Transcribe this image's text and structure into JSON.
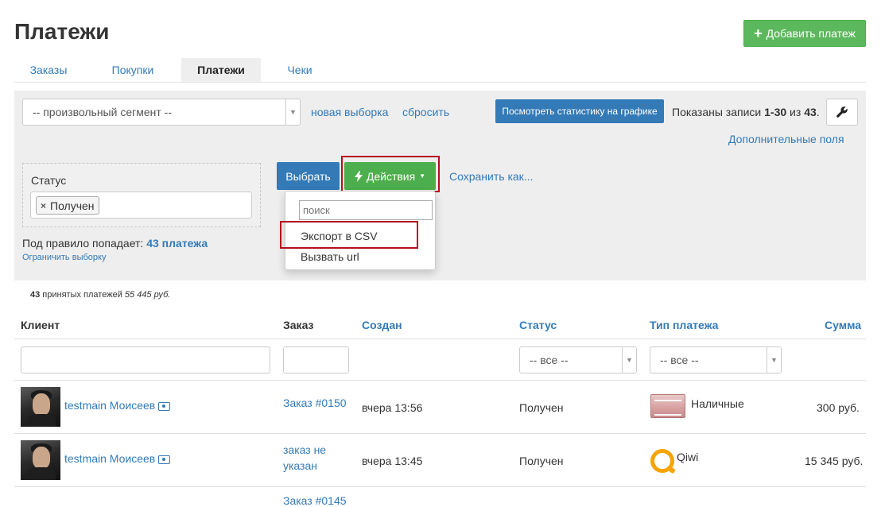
{
  "header": {
    "title": "Платежи",
    "add_button": "Добавить платеж"
  },
  "tabs": [
    {
      "label": "Заказы"
    },
    {
      "label": "Покупки"
    },
    {
      "label": "Платежи",
      "active": true
    },
    {
      "label": "Чеки"
    }
  ],
  "filter": {
    "segment_select": "-- произвольный сегмент --",
    "new_selection": "новая выборка",
    "reset": "сбросить",
    "stats_button": "Посмотреть статистику на графике",
    "shown_prefix": "Показаны записи ",
    "shown_range": "1-30",
    "shown_mid": " из ",
    "shown_total": "43",
    "shown_suffix": ".",
    "extra_fields": "Дополнительные поля",
    "status_label": "Статус",
    "status_tag": "Получен",
    "rule_prefix": "Под правило попадает: ",
    "rule_count": "43 платежа",
    "limit_link": "Ограничить выборку",
    "choose_button": "Выбрать",
    "actions_button": "Действия",
    "save_as": "Сохранить как..."
  },
  "actions_dropdown": {
    "search_placeholder": "поиск",
    "items": [
      "Экспорт в CSV",
      "Вызвать url"
    ]
  },
  "summary": {
    "count": "43",
    "text": " принятых платежей ",
    "amount": "55 445 руб."
  },
  "table": {
    "headers": {
      "client": "Клиент",
      "order": "Заказ",
      "created": "Создан",
      "status": "Статус",
      "payment_type": "Тип платежа",
      "amount": "Сумма"
    },
    "status_filter": "-- все --",
    "type_filter": "-- все --",
    "rows": [
      {
        "client": "testmain Моисеев",
        "order": "Заказ #0150",
        "created": "вчера 13:56",
        "status": "Получен",
        "payment_type": "Наличные",
        "amount": "300 руб."
      },
      {
        "client": "testmain Моисеев",
        "order_line1": "заказ не",
        "order_line2": "указан",
        "created": "вчера 13:45",
        "status": "Получен",
        "payment_type": "Qiwi",
        "amount": "15 345 руб."
      },
      {
        "order": "Заказ #0145"
      }
    ]
  },
  "colors": {
    "primary": "#337ab7",
    "success": "#5cb85c",
    "highlight": "#b50e1b",
    "panel": "#eeeeee"
  }
}
